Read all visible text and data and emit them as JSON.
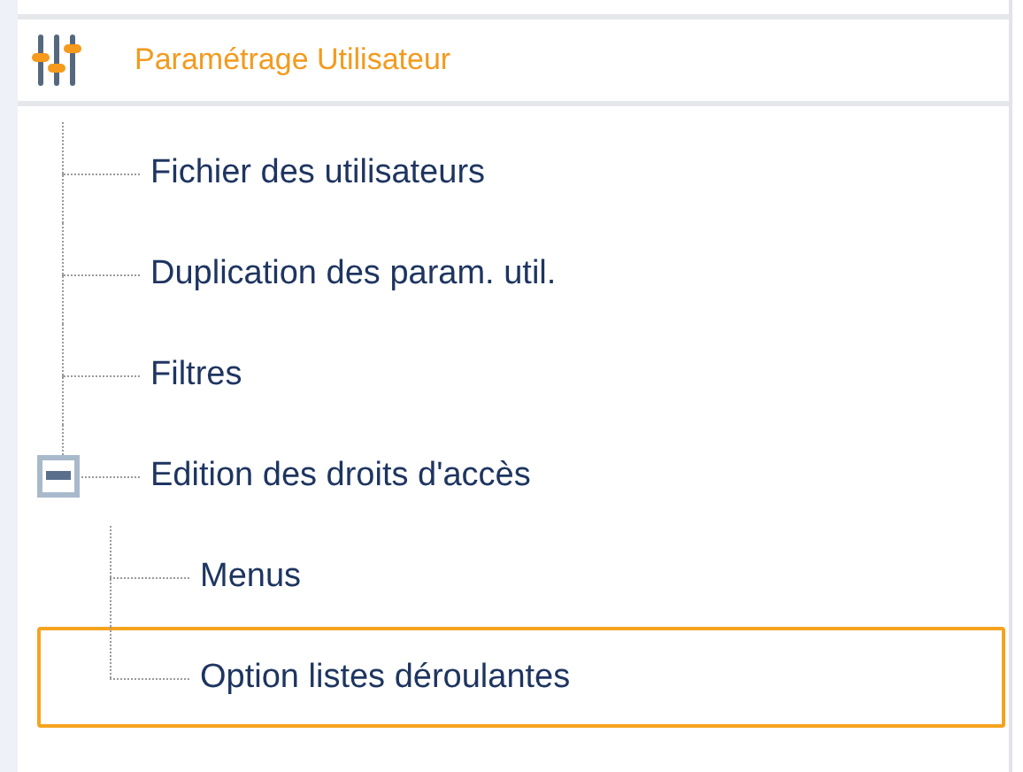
{
  "header": {
    "title": "Paramétrage Utilisateur"
  },
  "tree": [
    {
      "label": "Fichier des utilisateurs",
      "selected": false
    },
    {
      "label": "Duplication des param. util.",
      "selected": false
    },
    {
      "label": "Filtres",
      "selected": false
    },
    {
      "label": "Edition des droits d'accès",
      "selected": false,
      "expanded": true,
      "children": [
        {
          "label": "Menus",
          "selected": false
        },
        {
          "label": "Option listes déroulantes",
          "selected": true
        }
      ]
    }
  ]
}
